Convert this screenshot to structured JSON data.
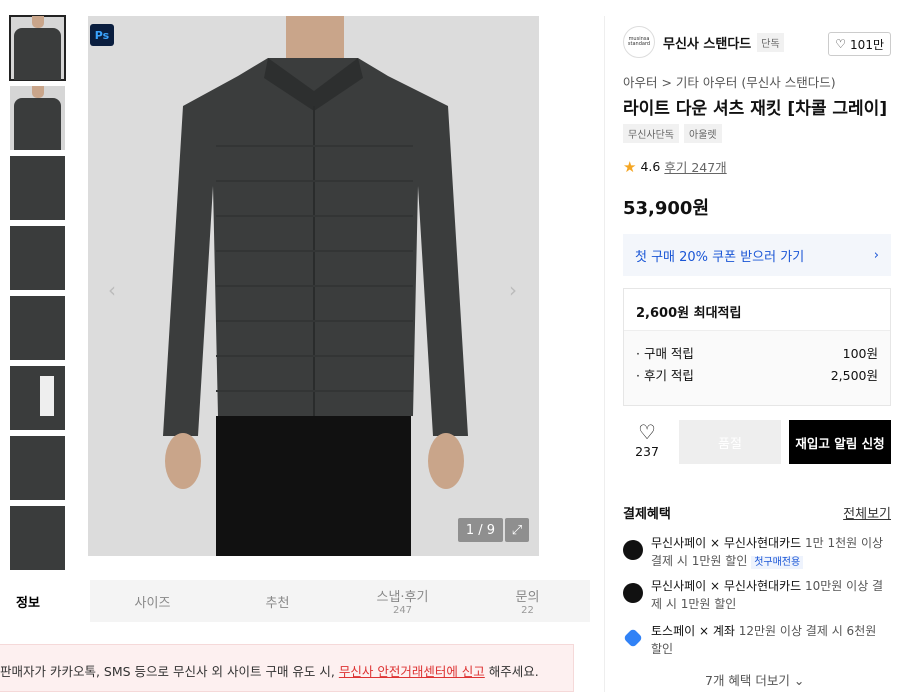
{
  "gallery": {
    "thumb_count": 8,
    "ps_badge": "Ps",
    "counter": "1 / 9"
  },
  "tabs": [
    {
      "label": "정보",
      "count": ""
    },
    {
      "label": "사이즈",
      "count": ""
    },
    {
      "label": "추천",
      "count": ""
    },
    {
      "label": "스냅·후기",
      "count": "247"
    },
    {
      "label": "문의",
      "count": "22"
    }
  ],
  "warning": {
    "prefix": "판매자가 카카오톡, SMS 등으로 무신사 외 사이트 구매 유도 시, ",
    "link": "무신사 안전거래센터에 신고",
    "suffix": " 해주세요."
  },
  "brand": {
    "logo_text": "musinsa standard",
    "name": "무신사 스탠다드",
    "tag": "단독",
    "likes": "101만"
  },
  "breadcrumb": "아우터 > 기타 아우터 (무신사 스탠다드)",
  "product": {
    "title": "라이트 다운 셔츠 재킷 [차콜 그레이]",
    "tags": [
      "무신사단독",
      "아울렛"
    ],
    "rating": "4.6",
    "reviews": "후기 247개",
    "price": "53,900원"
  },
  "coupon": {
    "label": "첫 구매 20% 쿠폰 받으러 가기"
  },
  "points": {
    "max": "2,600원 최대적립",
    "rows": [
      {
        "label": "· 구매 적립",
        "value": "100원"
      },
      {
        "label": "· 후기 적립",
        "value": "2,500원"
      }
    ]
  },
  "actions": {
    "wish_count": "237",
    "soldout": "품절",
    "restock": "재입고 알림 신청"
  },
  "payment": {
    "title": "결제혜택",
    "all": "전체보기",
    "benefits": [
      {
        "name": "무신사페이 × 무신사현대카드",
        "desc": " 1만 1천원 이상 결제 시 1만원 할인",
        "chip": "첫구매전용"
      },
      {
        "name": "무신사페이 × 무신사현대카드",
        "desc": " 10만원 이상 결제 시 1만원 할인",
        "chip": ""
      },
      {
        "name": "토스페이 × 계좌",
        "desc": " 12만원 이상 결제 시 6천원 할인",
        "chip": ""
      }
    ],
    "more": "7개 혜택 더보기"
  },
  "colors": {
    "coupon_text": "#1a56d6",
    "restock_bg": "#000000",
    "star": "#f5a623"
  }
}
